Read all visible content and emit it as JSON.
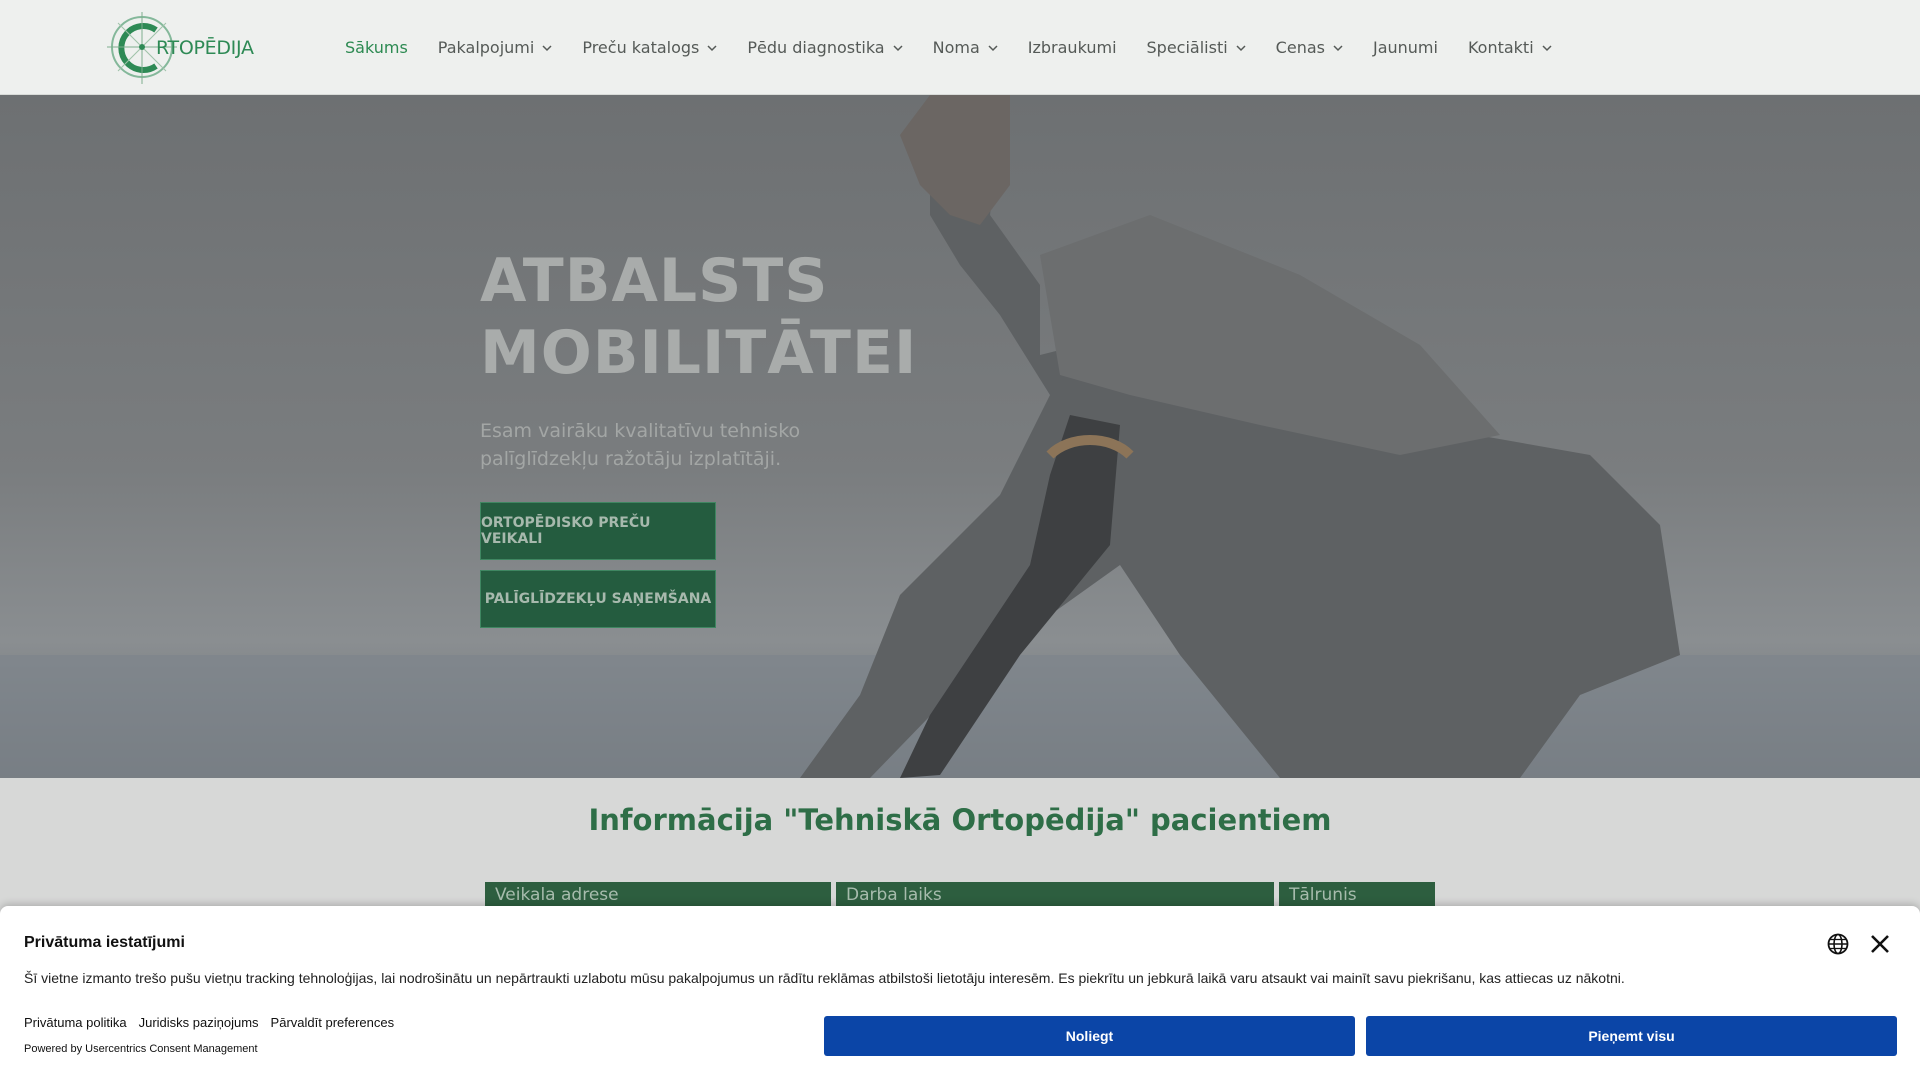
{
  "header": {
    "logo_text": "RTOPĒDIJA",
    "nav": [
      {
        "label": "Sākums",
        "active": true,
        "has_dropdown": false
      },
      {
        "label": "Pakalpojumi",
        "active": false,
        "has_dropdown": true
      },
      {
        "label": "Preču katalogs",
        "active": false,
        "has_dropdown": true
      },
      {
        "label": "Pēdu diagnostika",
        "active": false,
        "has_dropdown": true
      },
      {
        "label": "Noma",
        "active": false,
        "has_dropdown": true
      },
      {
        "label": "Izbraukumi",
        "active": false,
        "has_dropdown": false
      },
      {
        "label": "Speciālisti",
        "active": false,
        "has_dropdown": true
      },
      {
        "label": "Cenas",
        "active": false,
        "has_dropdown": true
      },
      {
        "label": "Jaunumi",
        "active": false,
        "has_dropdown": false
      },
      {
        "label": "Kontakti",
        "active": false,
        "has_dropdown": true
      }
    ]
  },
  "hero": {
    "title_line1": "ATBALSTS",
    "title_line2": "MOBILITĀTEI",
    "subtitle": "Esam vairāku kvalitatīvu tehnisko palīglīdzekļu ražotāju izplatītāji.",
    "button_shops": "ORTOPĒDISKO PREČU VEIKALI",
    "button_aids": "PALĪGLĪDZEKĻU SAŅEMŠANA"
  },
  "info": {
    "title": "Informācija \"Tehniskā Ortopēdija\" pacientiem",
    "columns": [
      "Veikala adrese",
      "Darba laiks",
      "Tālrunis"
    ]
  },
  "consent": {
    "title": "Privātuma iestatījumi",
    "text": "Šī vietne izmanto trešo pušu vietņu tracking tehnoloģijas, lai nodrošinātu un nepārtraukti uzlabotu mūsu pakalpojumus un rādītu reklāmas atbilstoši lietotāju interesēm. Es piekrītu un jebkurā laikā varu atsaukt vai mainīt savu piekrišanu, kas attiecas uz nākotni.",
    "links": [
      "Privātuma politika",
      "Juridisks paziņojums",
      "Pārvaldīt preferences"
    ],
    "powered": "Powered by Usercentrics Consent Management",
    "deny_label": "Noliegt",
    "accept_label": "Pieņemt visu"
  },
  "colors": {
    "brand_green": "#2d8a52",
    "consent_button": "#0b45a7"
  }
}
